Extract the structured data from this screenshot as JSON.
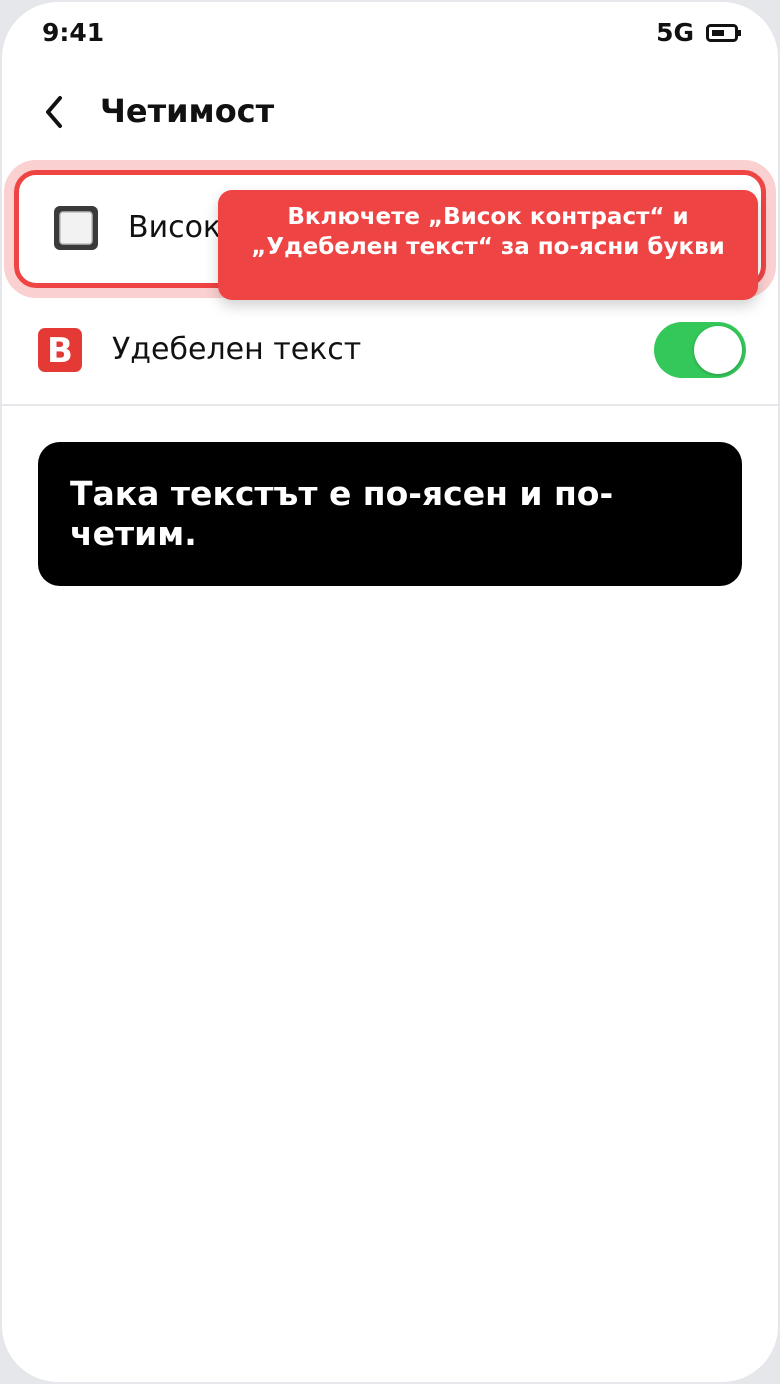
{
  "status_bar": {
    "time": "9:41",
    "network": "5G",
    "battery_icon": "battery-icon"
  },
  "header": {
    "back_icon": "chevron-left-icon",
    "title": "Четимост"
  },
  "settings": [
    {
      "id": "high-contrast",
      "label": "Висок контраст",
      "icon": "white-square-button-icon",
      "highlighted": true,
      "highlight_color": "#ef4444"
    },
    {
      "id": "bold-text",
      "label": "Удебелен текст",
      "icon": "letter-b-icon",
      "toggle_on": true,
      "toggle_color": "#34c759"
    }
  ],
  "tooltip": {
    "text": "Включете „Висок контраст“ и „Удебелен текст“ за по-ясни букви",
    "background": "#ef4444"
  },
  "info_card": {
    "text": "Така текстът е по-ясен и по-четим.",
    "background": "#000000"
  }
}
